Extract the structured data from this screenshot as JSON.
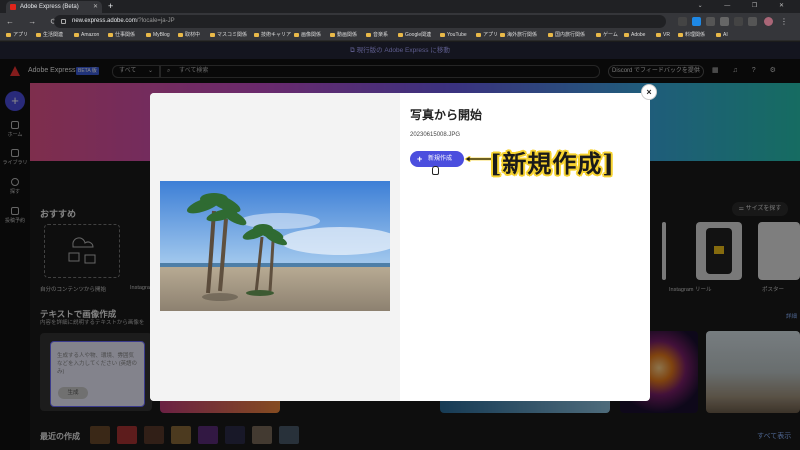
{
  "browser": {
    "tab_title": "Adobe Express (Beta)",
    "url_host": "new.express.adobe.com",
    "url_rest": "/?locale=ja-JP",
    "bookmarks": [
      "アプリ",
      "生活関連",
      "Amazon",
      "仕事関係",
      "MyBlog",
      "取材中",
      "マスコミ関係",
      "技術キャリア",
      "画像関係",
      "動画関係",
      "音楽系",
      "Google関連",
      "YouTube",
      "アプリ",
      "海外旅行関係",
      "国内旅行関係",
      "ゲーム",
      "Adobe",
      "VR",
      "料理関係",
      "AI"
    ]
  },
  "notice": "現行版の Adobe Express に移動",
  "header": {
    "brand": "Adobe Express",
    "beta": "BETA 版",
    "category": "すべて",
    "search_placeholder": "すべて検索",
    "discord": "Discord でフィードバックを提供"
  },
  "sidebar": {
    "home": "ホーム",
    "library": "ライブラリ",
    "explore": "探す",
    "scheduled": "投稿予約"
  },
  "main": {
    "recommend_title": "おすすめ",
    "size_button": "サイズを探す",
    "own_content": "自分のコンテンツから開始",
    "instagram_short": "Instagra",
    "instagram_reel": "Instagram リール",
    "poster": "ポスター",
    "text_section_title": "テキストで画像作成",
    "text_section_sub": "内容を詳細に説明するテキストから画像を",
    "details_link": "詳細",
    "prompt_placeholder": "生成する人や物、環境、雰囲気などを入力してください (英語のみ)",
    "generate_button": "生成",
    "recent_title": "最近の作成",
    "see_all": "すべて表示"
  },
  "modal": {
    "title": "写真から開始",
    "filename": "20230615008.JPG",
    "new_button": "新規作成",
    "close": "×"
  },
  "annotation": "[新規作成]",
  "colors": {
    "accent": "#4b4ede",
    "annotation_outline": "#f6d22f"
  }
}
